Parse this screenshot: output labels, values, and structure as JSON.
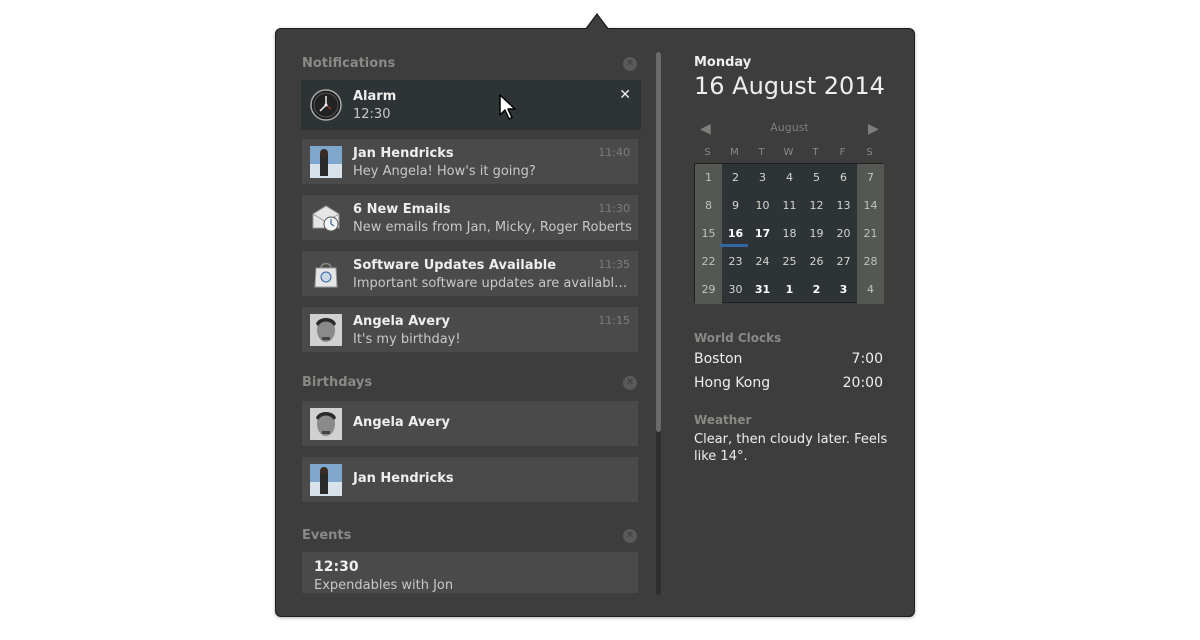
{
  "notifications": {
    "title": "Notifications",
    "items": [
      {
        "title": "Alarm",
        "body": "12:30",
        "time": "",
        "icon": "alarm-clock-icon",
        "selected": true
      },
      {
        "title": "Jan Hendricks",
        "body": "Hey Angela! How's it going?",
        "time": "11:40",
        "icon": "avatar-jan"
      },
      {
        "title": "6 New Emails",
        "body": "New emails from Jan, Micky, Roger Roberts",
        "time": "11:30",
        "icon": "mail-icon"
      },
      {
        "title": "Software Updates Available",
        "body": "Important software updates are available to install",
        "time": "11:35",
        "icon": "software-bag-icon"
      },
      {
        "title": "Angela Avery",
        "body": "It's my birthday!",
        "time": "11:15",
        "icon": "avatar-angela"
      }
    ]
  },
  "birthdays": {
    "title": "Birthdays",
    "items": [
      {
        "title": "Angela Avery",
        "icon": "avatar-angela"
      },
      {
        "title": "Jan Hendricks",
        "icon": "avatar-jan"
      }
    ]
  },
  "events": {
    "title": "Events",
    "items": [
      {
        "time": "12:30",
        "title": "Expendables with Jon"
      }
    ]
  },
  "calendar": {
    "day_name": "Monday",
    "date": "16 August 2014",
    "month": "August",
    "weekdays": [
      "S",
      "M",
      "T",
      "W",
      "T",
      "F",
      "S"
    ],
    "weeks": [
      [
        "1",
        "2",
        "3",
        "4",
        "5",
        "6",
        "7"
      ],
      [
        "8",
        "9",
        "10",
        "11",
        "12",
        "13",
        "14"
      ],
      [
        "15",
        "16",
        "17",
        "18",
        "19",
        "20",
        "21"
      ],
      [
        "22",
        "23",
        "24",
        "25",
        "26",
        "27",
        "28"
      ],
      [
        "29",
        "30",
        "31",
        "1",
        "2",
        "3",
        "4"
      ]
    ]
  },
  "world_clocks": {
    "title": "World Clocks",
    "items": [
      {
        "city": "Boston",
        "time": "7:00"
      },
      {
        "city": "Hong Kong",
        "time": "20:00"
      }
    ]
  },
  "weather": {
    "title": "Weather",
    "text": "Clear, then cloudy later. Feels like 14°."
  },
  "colors": {
    "background": "#3d3d3d",
    "card": "#4a4a4a",
    "selected_card": "#2e3436",
    "accent": "#3465a4"
  }
}
